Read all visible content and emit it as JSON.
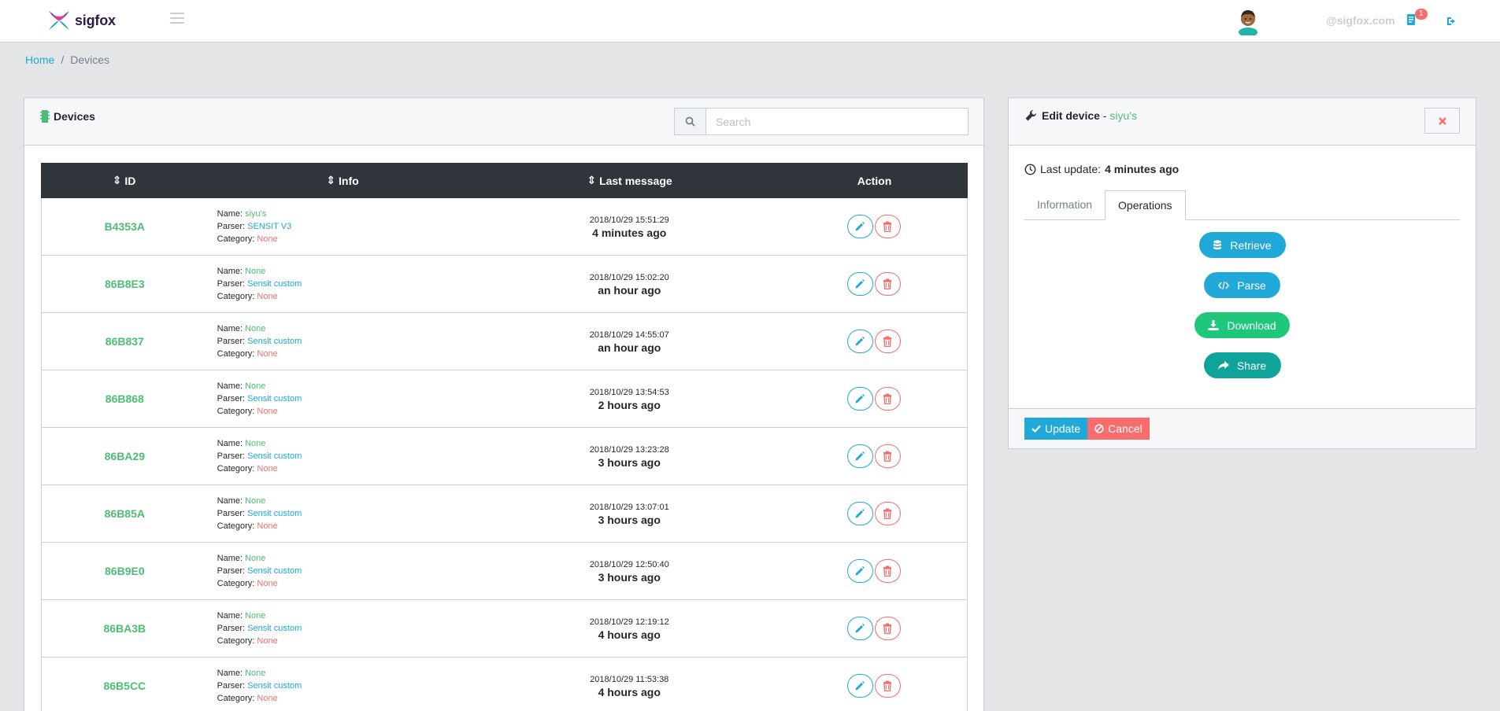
{
  "header": {
    "logo_text": "sigfox",
    "user_email": "@sigfox.com",
    "notification_count": "1"
  },
  "breadcrumb": {
    "home": "Home",
    "current": "Devices"
  },
  "devices_card": {
    "title": "Devices",
    "search_placeholder": "Search",
    "columns": {
      "id": "ID",
      "info": "Info",
      "last": "Last message",
      "action": "Action"
    },
    "labels": {
      "name": "Name: ",
      "parser": "Parser: ",
      "category": "Category: "
    },
    "rows": [
      {
        "id": "B4353A",
        "name": "siyu's",
        "parser": "SENSIT V3",
        "category": "None",
        "date": "2018/10/29 15:51:29",
        "ago": "4 minutes ago"
      },
      {
        "id": "86B8E3",
        "name": "None",
        "parser": "Sensit custom",
        "category": "None",
        "date": "2018/10/29 15:02:20",
        "ago": "an hour ago"
      },
      {
        "id": "86B837",
        "name": "None",
        "parser": "Sensit custom",
        "category": "None",
        "date": "2018/10/29 14:55:07",
        "ago": "an hour ago"
      },
      {
        "id": "86B868",
        "name": "None",
        "parser": "Sensit custom",
        "category": "None",
        "date": "2018/10/29 13:54:53",
        "ago": "2 hours ago"
      },
      {
        "id": "86BA29",
        "name": "None",
        "parser": "Sensit custom",
        "category": "None",
        "date": "2018/10/29 13:23:28",
        "ago": "3 hours ago"
      },
      {
        "id": "86B85A",
        "name": "None",
        "parser": "Sensit custom",
        "category": "None",
        "date": "2018/10/29 13:07:01",
        "ago": "3 hours ago"
      },
      {
        "id": "86B9E0",
        "name": "None",
        "parser": "Sensit custom",
        "category": "None",
        "date": "2018/10/29 12:50:40",
        "ago": "3 hours ago"
      },
      {
        "id": "86BA3B",
        "name": "None",
        "parser": "Sensit custom",
        "category": "None",
        "date": "2018/10/29 12:19:12",
        "ago": "4 hours ago"
      },
      {
        "id": "86B5CC",
        "name": "None",
        "parser": "Sensit custom",
        "category": "None",
        "date": "2018/10/29 11:53:38",
        "ago": "4 hours ago"
      }
    ]
  },
  "edit_card": {
    "title": "Edit device",
    "separator": " - ",
    "device_name": "siyu's",
    "last_update_label": "Last update: ",
    "last_update_value": "4 minutes ago",
    "tabs": [
      "Information",
      "Operations"
    ],
    "active_tab": "Operations",
    "operations": {
      "retrieve": "Retrieve",
      "parse": "Parse",
      "download": "Download",
      "share": "Share"
    },
    "update_label": "Update",
    "cancel_label": "Cancel"
  },
  "colors": {
    "primary": "#20a8d8",
    "success": "#4dbd74",
    "danger": "#f86c6b",
    "dark": "#2f353a",
    "download": "#1ec779",
    "share": "#0fa39a"
  },
  "icons": {
    "header": [
      "sigfox-logo-icon",
      "hamburger-icon",
      "avatar",
      "notification-icon",
      "logout-icon"
    ],
    "card": [
      "device-icon",
      "search-icon",
      "sort-icon",
      "pencil-icon",
      "trash-icon"
    ],
    "edit": [
      "wrench-icon",
      "close-icon",
      "clock-icon",
      "database-icon",
      "code-icon",
      "download-icon",
      "share-icon",
      "check-icon",
      "ban-icon"
    ]
  }
}
